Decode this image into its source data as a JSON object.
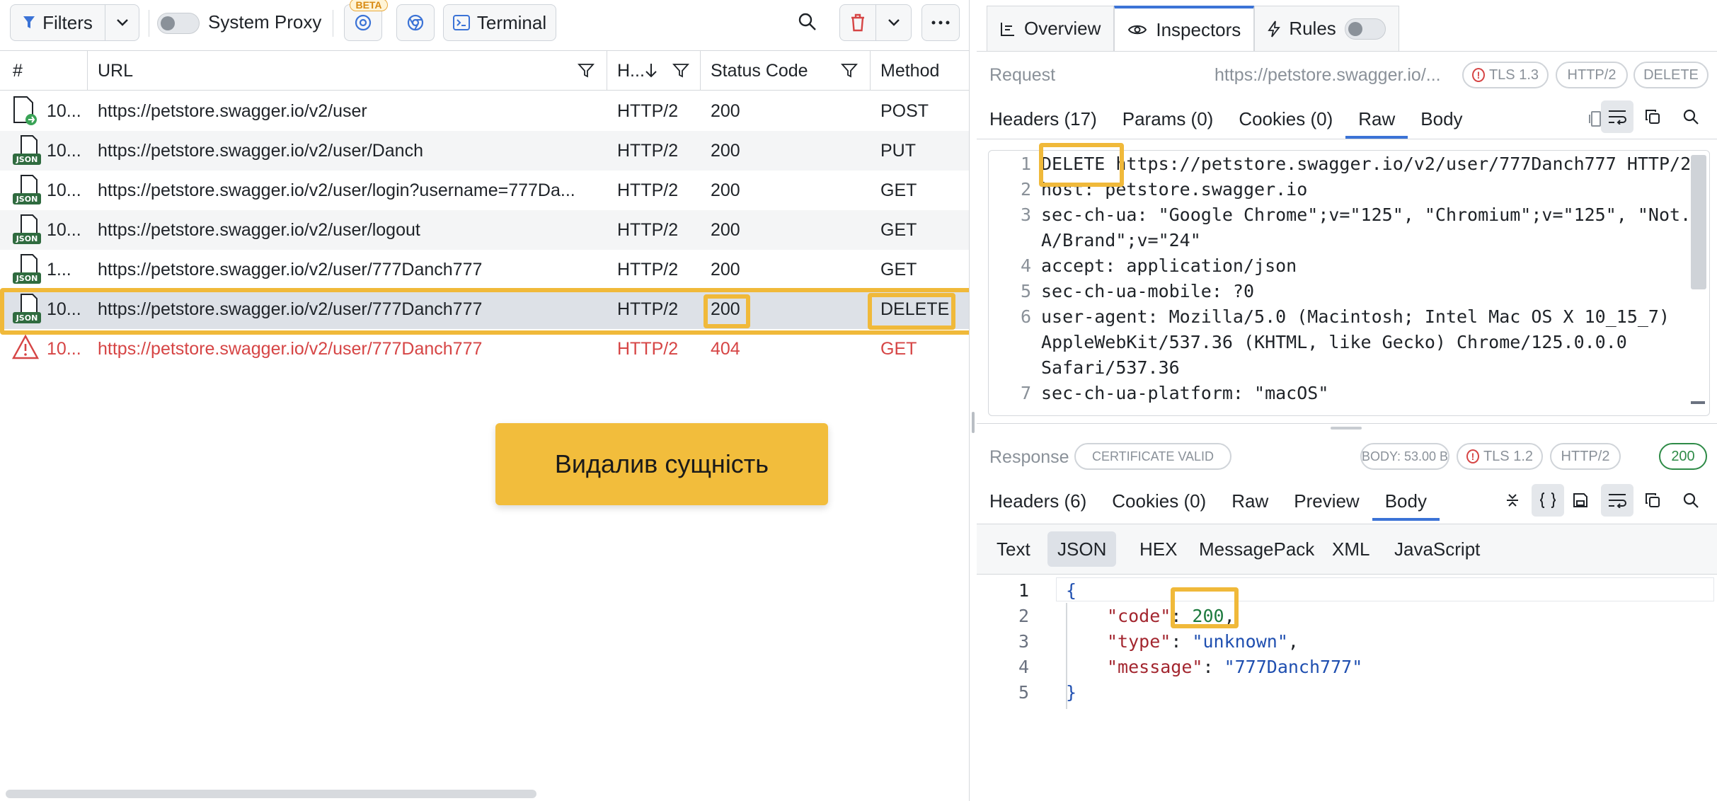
{
  "toolbar": {
    "filters_label": "Filters",
    "system_proxy_label": "System Proxy",
    "beta_badge": "BETA",
    "terminal_label": "Terminal"
  },
  "table": {
    "headers": {
      "num": "#",
      "url": "URL",
      "http": "H...",
      "status": "Status Code",
      "method": "Method"
    },
    "rows": [
      {
        "icon": "file-upload-icon",
        "num": "10...",
        "url": "https://petstore.swagger.io/v2/user",
        "http": "HTTP/2",
        "status": "200",
        "method": "POST"
      },
      {
        "icon": "json-file-icon",
        "num": "10...",
        "url": "https://petstore.swagger.io/v2/user/Danch",
        "http": "HTTP/2",
        "status": "200",
        "method": "PUT"
      },
      {
        "icon": "json-file-icon",
        "num": "10...",
        "url": "https://petstore.swagger.io/v2/user/login?username=777Da...",
        "http": "HTTP/2",
        "status": "200",
        "method": "GET"
      },
      {
        "icon": "json-file-icon",
        "num": "10...",
        "url": "https://petstore.swagger.io/v2/user/logout",
        "http": "HTTP/2",
        "status": "200",
        "method": "GET"
      },
      {
        "icon": "json-file-icon",
        "num": "1...",
        "url": "https://petstore.swagger.io/v2/user/777Danch777",
        "http": "HTTP/2",
        "status": "200",
        "method": "GET"
      },
      {
        "icon": "json-file-icon",
        "num": "10...",
        "url": "https://petstore.swagger.io/v2/user/777Danch777",
        "http": "HTTP/2",
        "status": "200",
        "method": "DELETE"
      },
      {
        "icon": "warning-icon",
        "num": "10...",
        "url": "https://petstore.swagger.io/v2/user/777Danch777",
        "http": "HTTP/2",
        "status": "404",
        "method": "GET"
      }
    ]
  },
  "callout": "Видалив сущність",
  "inspector": {
    "tabs": {
      "overview": "Overview",
      "inspectors": "Inspectors",
      "rules": "Rules"
    },
    "request": {
      "label": "Request",
      "url": "https://petstore.swagger.io/...",
      "pills": {
        "tls": "TLS 1.3",
        "http": "HTTP/2",
        "method": "DELETE"
      },
      "tabs": [
        "Headers (17)",
        "Params (0)",
        "Cookies (0)",
        "Raw",
        "Body"
      ],
      "raw_lines": [
        {
          "n": "1",
          "text": "DELETE https://petstore.swagger.io/v2/user/777Danch777 HTTP/2"
        },
        {
          "n": "2",
          "text": "host: petstore.swagger.io"
        },
        {
          "n": "3",
          "text": "sec-ch-ua: \"Google Chrome\";v=\"125\", \"Chromium\";v=\"125\", \"Not."
        },
        {
          "n": "",
          "text": "A/Brand\";v=\"24\""
        },
        {
          "n": "4",
          "text": "accept: application/json"
        },
        {
          "n": "5",
          "text": "sec-ch-ua-mobile: ?0"
        },
        {
          "n": "6",
          "text": "user-agent: Mozilla/5.0 (Macintosh; Intel Mac OS X 10_15_7)"
        },
        {
          "n": "",
          "text": "AppleWebKit/537.36 (KHTML, like Gecko) Chrome/125.0.0.0"
        },
        {
          "n": "",
          "text": "Safari/537.36"
        },
        {
          "n": "7",
          "text": "sec-ch-ua-platform: \"macOS\""
        }
      ]
    },
    "response": {
      "label": "Response",
      "pills": {
        "cert": "CERTIFICATE VALID",
        "body": "BODY: 53.00 B",
        "tls": "TLS 1.2",
        "http": "HTTP/2",
        "status": "200"
      },
      "tabs": [
        "Headers (6)",
        "Cookies (0)",
        "Raw",
        "Preview",
        "Body"
      ],
      "formats": [
        "Text",
        "JSON",
        "HEX",
        "MessagePack",
        "XML",
        "JavaScript"
      ],
      "json": {
        "code_key": "\"code\"",
        "code_val": "200",
        "type_key": "\"type\"",
        "type_val": "\"unknown\"",
        "message_key": "\"message\"",
        "message_val": "\"777Danch777\""
      }
    }
  },
  "colors": {
    "accent": "#3b73d6",
    "highlight": "#f0b93a",
    "error": "#d64545",
    "success": "#2e8b47"
  }
}
